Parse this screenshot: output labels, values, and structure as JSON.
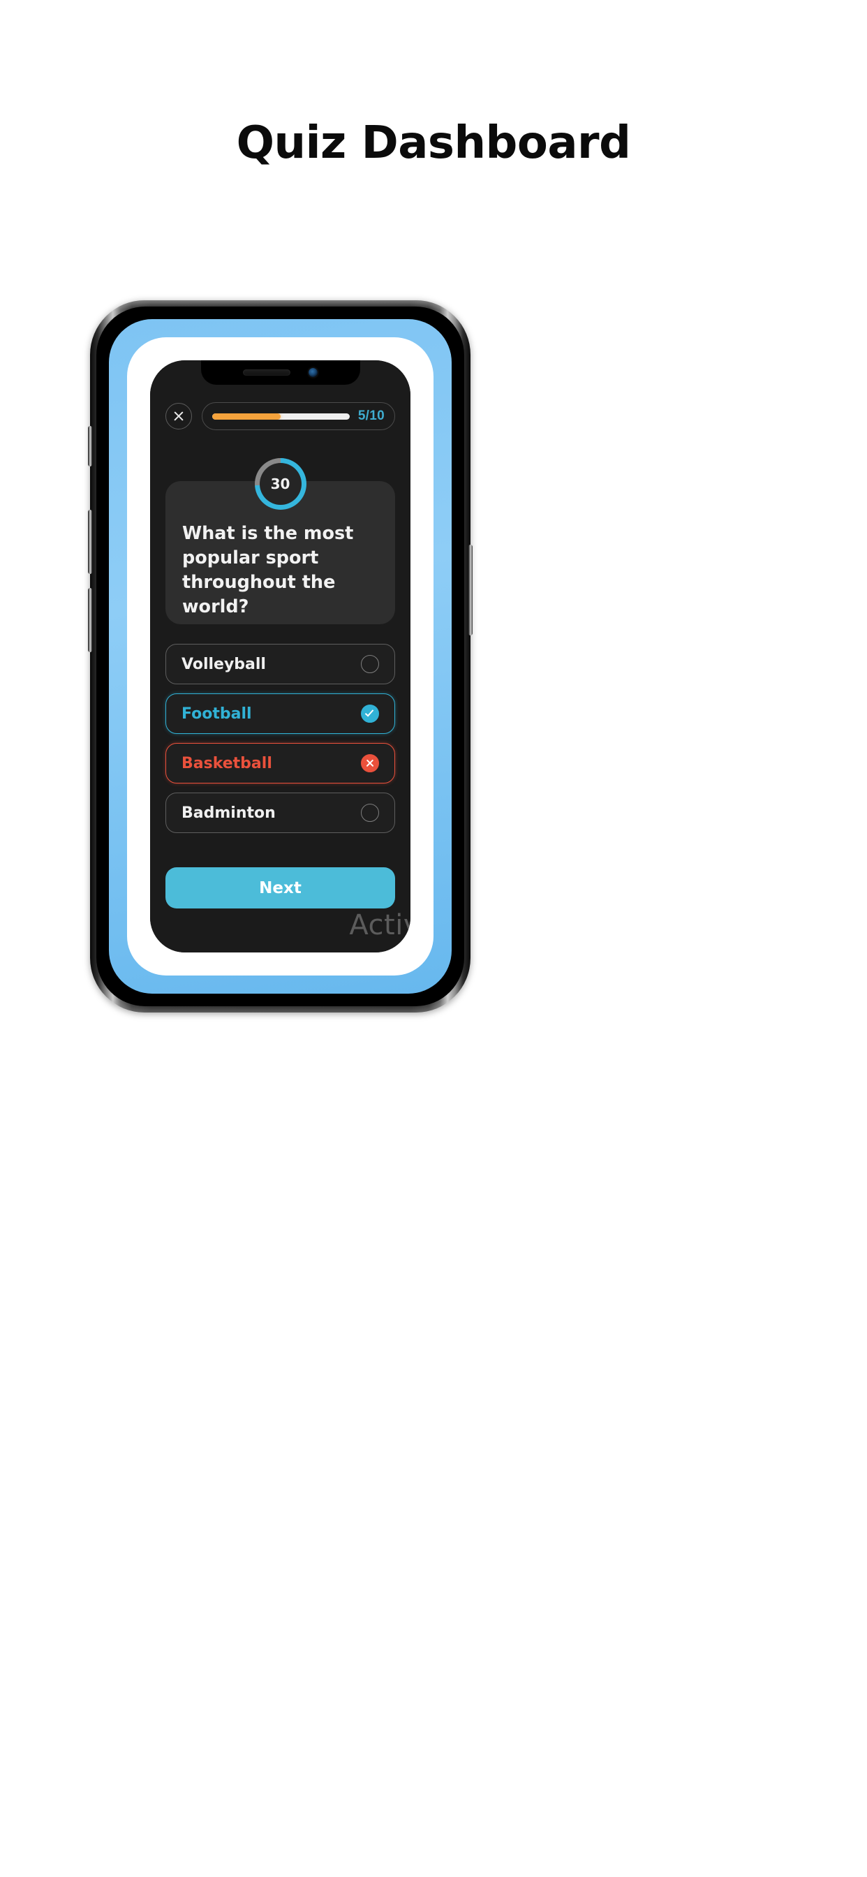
{
  "page": {
    "title": "Quiz Dashboard",
    "background": "#ffffff"
  },
  "device": {
    "type": "smartphone-mockup",
    "notch": {
      "speaker": "speaker-grille",
      "camera": "front-camera"
    },
    "accent_ring_color": "#8ecdf6"
  },
  "app": {
    "background": "#1b1b1b",
    "topbar": {
      "close_icon": "close-x-icon",
      "progress": {
        "current": 5,
        "total": 10,
        "label": "5/10",
        "percent": 50,
        "fill_color": "#f5a33c",
        "track_color": "#efefef",
        "label_color": "#3fadd0"
      }
    },
    "timer": {
      "value": "30",
      "seconds_remaining": 30,
      "total_seconds": 40,
      "progress_percent": 74,
      "ring_color": "#35b6dd",
      "track_color": "#8a8a8a"
    },
    "question": {
      "text": "What is the most popular sport throughout the world?",
      "card_color": "#2e2e2e"
    },
    "options": [
      {
        "label": "Volleyball",
        "state": "default",
        "marker": "radio-empty-icon",
        "border_color": "#5e5e5e",
        "text_color": "#f0f0f0"
      },
      {
        "label": "Football",
        "state": "correct",
        "marker": "check-circle-icon",
        "border_color": "#31b2d6",
        "text_color": "#31b2d6"
      },
      {
        "label": "Basketball",
        "state": "wrong",
        "marker": "cross-circle-icon",
        "border_color": "#ea513c",
        "text_color": "#ea513c"
      },
      {
        "label": "Badminton",
        "state": "default",
        "marker": "radio-empty-icon",
        "border_color": "#5e5e5e",
        "text_color": "#f0f0f0"
      }
    ],
    "next_button": {
      "label": "Next",
      "color": "#4cbcd9",
      "text_color": "#ffffff"
    },
    "watermark": {
      "text": "Activ"
    }
  }
}
